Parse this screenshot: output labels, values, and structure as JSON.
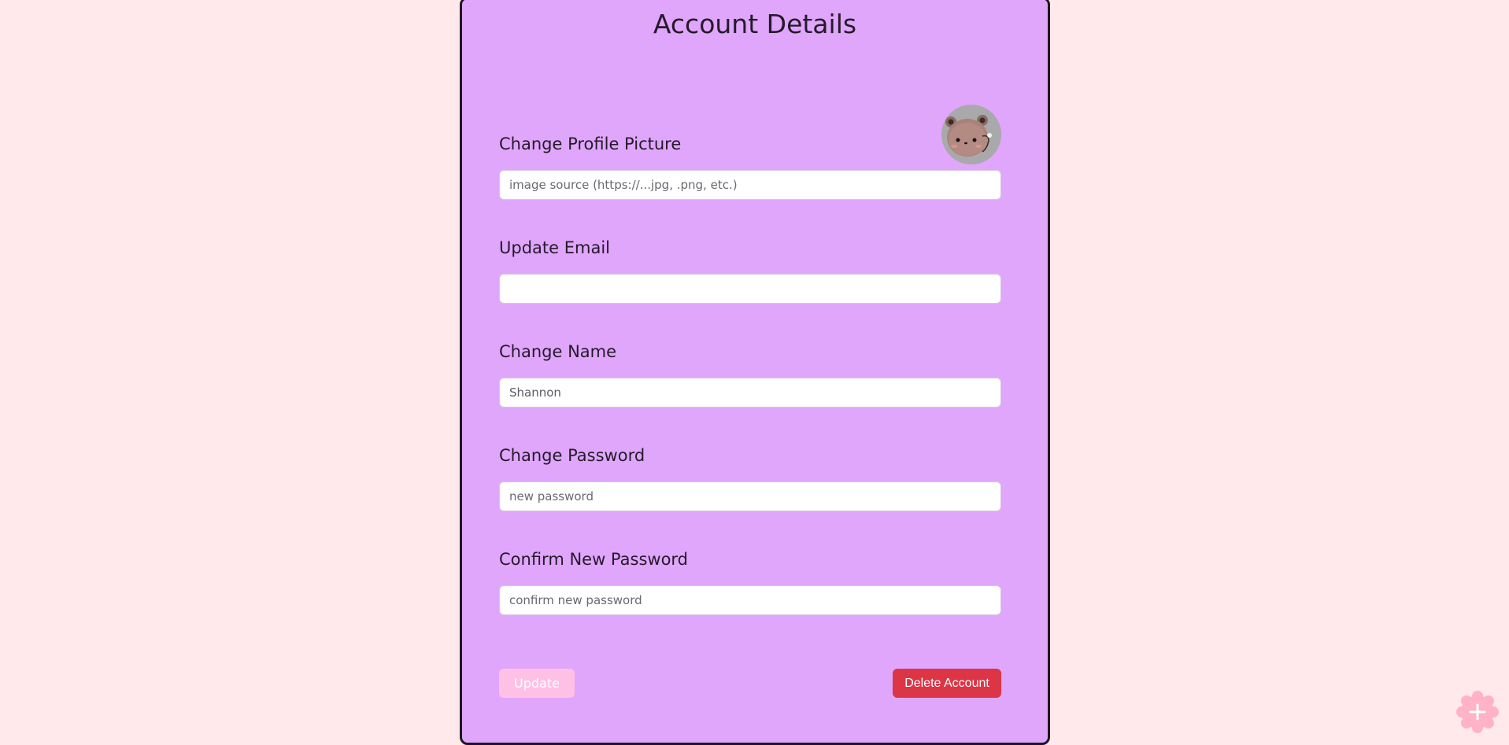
{
  "page": {
    "title": "Account Details"
  },
  "profile_picture": {
    "label": "Change Profile Picture",
    "placeholder": "image source (https://...jpg, .png, etc.)",
    "value": ""
  },
  "email": {
    "label": "Update Email",
    "placeholder": "",
    "value": ""
  },
  "name": {
    "label": "Change Name",
    "placeholder": "",
    "value": "Shannon"
  },
  "password": {
    "label": "Change Password",
    "placeholder": "new password",
    "value": ""
  },
  "confirm_password": {
    "label": "Confirm New Password",
    "placeholder": "confirm new password",
    "value": ""
  },
  "actions": {
    "update_label": "Update",
    "delete_label": "Delete Account"
  },
  "icons": {
    "avatar": "bear-avatar",
    "fab": "plus-icon"
  },
  "colors": {
    "page_background": "#ffe9ea",
    "panel_background": "#e0a6fb",
    "update_button": "#ffc0e6",
    "delete_button": "#dc3545",
    "fab": "#ffb3c4"
  }
}
